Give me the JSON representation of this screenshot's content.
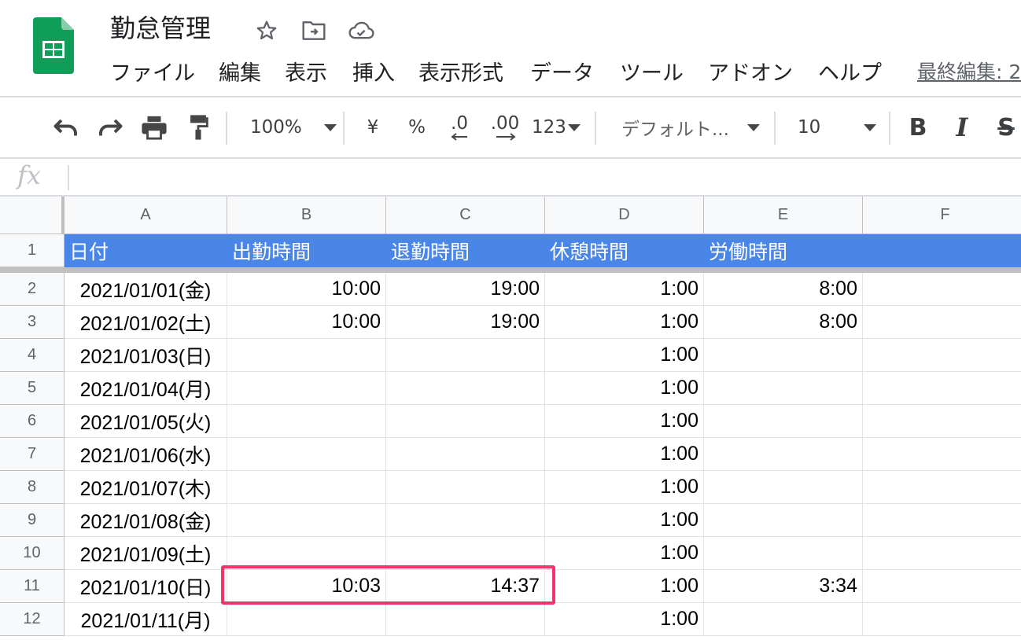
{
  "app": {
    "name": "Google Sheets"
  },
  "document": {
    "title": "勤怠管理"
  },
  "menu": {
    "items": [
      "ファイル",
      "編集",
      "表示",
      "挿入",
      "表示形式",
      "データ",
      "ツール",
      "アドオン",
      "ヘルプ"
    ],
    "last_edit": "最終編集: 2"
  },
  "toolbar": {
    "zoom": "100%",
    "currency": "¥",
    "percent": "%",
    "decrease_decimal": ".0",
    "increase_decimal": ".00",
    "number_format": "123",
    "font": "デフォルト...",
    "font_size": "10",
    "bold": "B",
    "italic": "I",
    "strikethrough": "S"
  },
  "formula_bar": {
    "fx_label": "fx",
    "value": ""
  },
  "colors": {
    "header_fill": "#4a86e8",
    "header_text": "#ffffff",
    "highlight_border": "#f0356b",
    "brand_green": "#0f9d58"
  },
  "grid": {
    "columns": [
      "A",
      "B",
      "C",
      "D",
      "E",
      "F"
    ],
    "row_numbers": [
      "1",
      "2",
      "3",
      "4",
      "5",
      "6",
      "7",
      "8",
      "9",
      "10",
      "11",
      "12"
    ],
    "header_row": [
      "日付",
      "出勤時間",
      "退勤時間",
      "休憩時間",
      "労働時間",
      ""
    ],
    "rows": [
      [
        "2021/01/01(金)",
        "10:00",
        "19:00",
        "1:00",
        "8:00",
        ""
      ],
      [
        "2021/01/02(土)",
        "10:00",
        "19:00",
        "1:00",
        "8:00",
        ""
      ],
      [
        "2021/01/03(日)",
        "",
        "",
        "1:00",
        "",
        ""
      ],
      [
        "2021/01/04(月)",
        "",
        "",
        "1:00",
        "",
        ""
      ],
      [
        "2021/01/05(火)",
        "",
        "",
        "1:00",
        "",
        ""
      ],
      [
        "2021/01/06(水)",
        "",
        "",
        "1:00",
        "",
        ""
      ],
      [
        "2021/01/07(木)",
        "",
        "",
        "1:00",
        "",
        ""
      ],
      [
        "2021/01/08(金)",
        "",
        "",
        "1:00",
        "",
        ""
      ],
      [
        "2021/01/09(土)",
        "",
        "",
        "1:00",
        "",
        ""
      ],
      [
        "2021/01/10(日)",
        "10:03",
        "14:37",
        "1:00",
        "3:34",
        ""
      ],
      [
        "2021/01/11(月)",
        "",
        "",
        "1:00",
        "",
        ""
      ]
    ]
  }
}
